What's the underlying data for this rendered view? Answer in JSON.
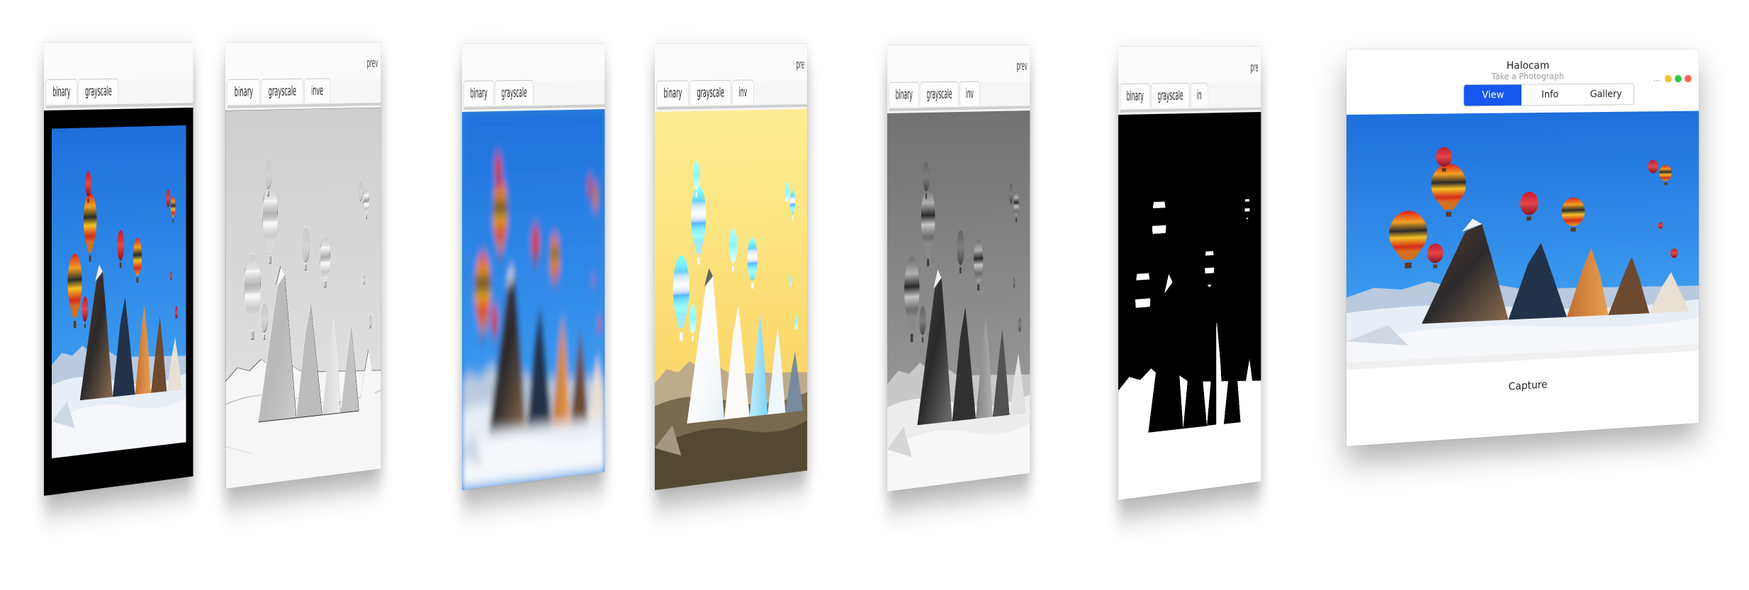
{
  "back_windows": [
    {
      "id": "w1",
      "title": "",
      "tabs": [
        "binary",
        "grayscale"
      ],
      "effect": "original"
    },
    {
      "id": "w2",
      "title": "prev",
      "tabs": [
        "binary",
        "grayscale",
        "inve"
      ],
      "effect": "emboss"
    },
    {
      "id": "w3",
      "title": "",
      "tabs": [
        "binary",
        "grayscale"
      ],
      "effect": "blur"
    },
    {
      "id": "w4",
      "title": "pre",
      "tabs": [
        "binary",
        "grayscale",
        "inv"
      ],
      "effect": "invert"
    },
    {
      "id": "w5",
      "title": "prev",
      "tabs": [
        "binary",
        "grayscale",
        "inv"
      ],
      "effect": "grayscale"
    },
    {
      "id": "w6",
      "title": "pre",
      "tabs": [
        "binary",
        "grayscale",
        "in"
      ],
      "effect": "binary"
    }
  ],
  "front": {
    "title": "Halocam",
    "subtitle": "Take a Photograph",
    "more": "...",
    "segments": [
      "View",
      "Info",
      "Gallery"
    ],
    "active_segment": "View",
    "capture_label": "Capture",
    "traffic_colors": [
      "#f5c02c",
      "#2fcb47",
      "#fe5f57"
    ]
  },
  "colors": {
    "accent": "#1757ee"
  }
}
